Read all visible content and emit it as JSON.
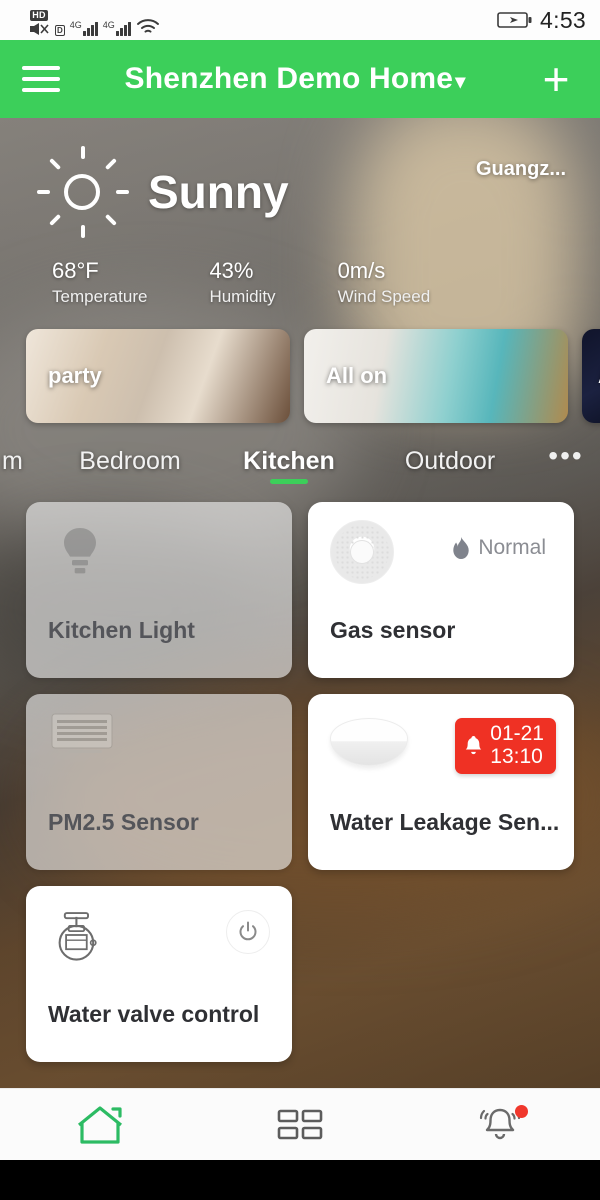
{
  "status_bar": {
    "hd_label": "HD",
    "data_label": "D",
    "network_label_1": "4G",
    "network_label_2": "4G",
    "icons": [
      "hd-icon",
      "no-sound-icon",
      "signal-4g-icon",
      "signal-4g-icon",
      "wifi-icon",
      "battery-charging-icon"
    ],
    "time": "4:53"
  },
  "app_bar": {
    "menu_icon": "hamburger-menu-icon",
    "title": "Shenzhen Demo Home",
    "dropdown_icon": "chevron-down-icon",
    "add_icon": "plus-icon",
    "background_color": "#3ccf5a"
  },
  "weather": {
    "icon": "sun-icon",
    "condition": "Sunny",
    "city": "Guangz...",
    "stats": [
      {
        "value": "68°F",
        "label": "Temperature"
      },
      {
        "value": "43%",
        "label": "Humidity"
      },
      {
        "value": "0m/s",
        "label": "Wind Speed"
      }
    ]
  },
  "scenes": [
    {
      "label": "party"
    },
    {
      "label": "All on"
    },
    {
      "label": "A"
    }
  ],
  "room_tabs": {
    "items": [
      {
        "label": "m",
        "active": false
      },
      {
        "label": "Bedroom",
        "active": false
      },
      {
        "label": "Kitchen",
        "active": true
      },
      {
        "label": "Outdoor",
        "active": false
      }
    ],
    "more_label": "•••",
    "active_indicator_color": "#3ccf5a"
  },
  "devices": [
    {
      "name": "Kitchen Light",
      "icon": "light-bulb-icon",
      "state": "offline",
      "status_text": "",
      "status_icon": ""
    },
    {
      "name": "Gas sensor",
      "icon": "gas-sensor-icon",
      "state": "active",
      "status_text": "Normal",
      "status_icon": "flame-icon"
    },
    {
      "name": "PM2.5 Sensor",
      "icon": "pm25-sensor-icon",
      "state": "offline",
      "status_text": "",
      "status_icon": ""
    },
    {
      "name": "Water Leakage Sen...",
      "icon": "water-leakage-sensor-icon",
      "state": "active",
      "alarm": {
        "icon": "bell-icon",
        "date": "01-21",
        "time": "13:10",
        "color": "#ef3124"
      }
    },
    {
      "name": "Water valve control",
      "icon": "water-valve-icon",
      "state": "active",
      "power_button_icon": "power-icon"
    }
  ],
  "bottom_nav": [
    {
      "icon": "home-icon",
      "active": true,
      "badge": false
    },
    {
      "icon": "grid-icon",
      "active": false,
      "badge": false
    },
    {
      "icon": "bell-ringing-icon",
      "active": false,
      "badge": true
    }
  ],
  "colors": {
    "accent_green": "#3ccf5a",
    "alarm_red": "#ef3124",
    "badge_red": "#f0372c"
  }
}
